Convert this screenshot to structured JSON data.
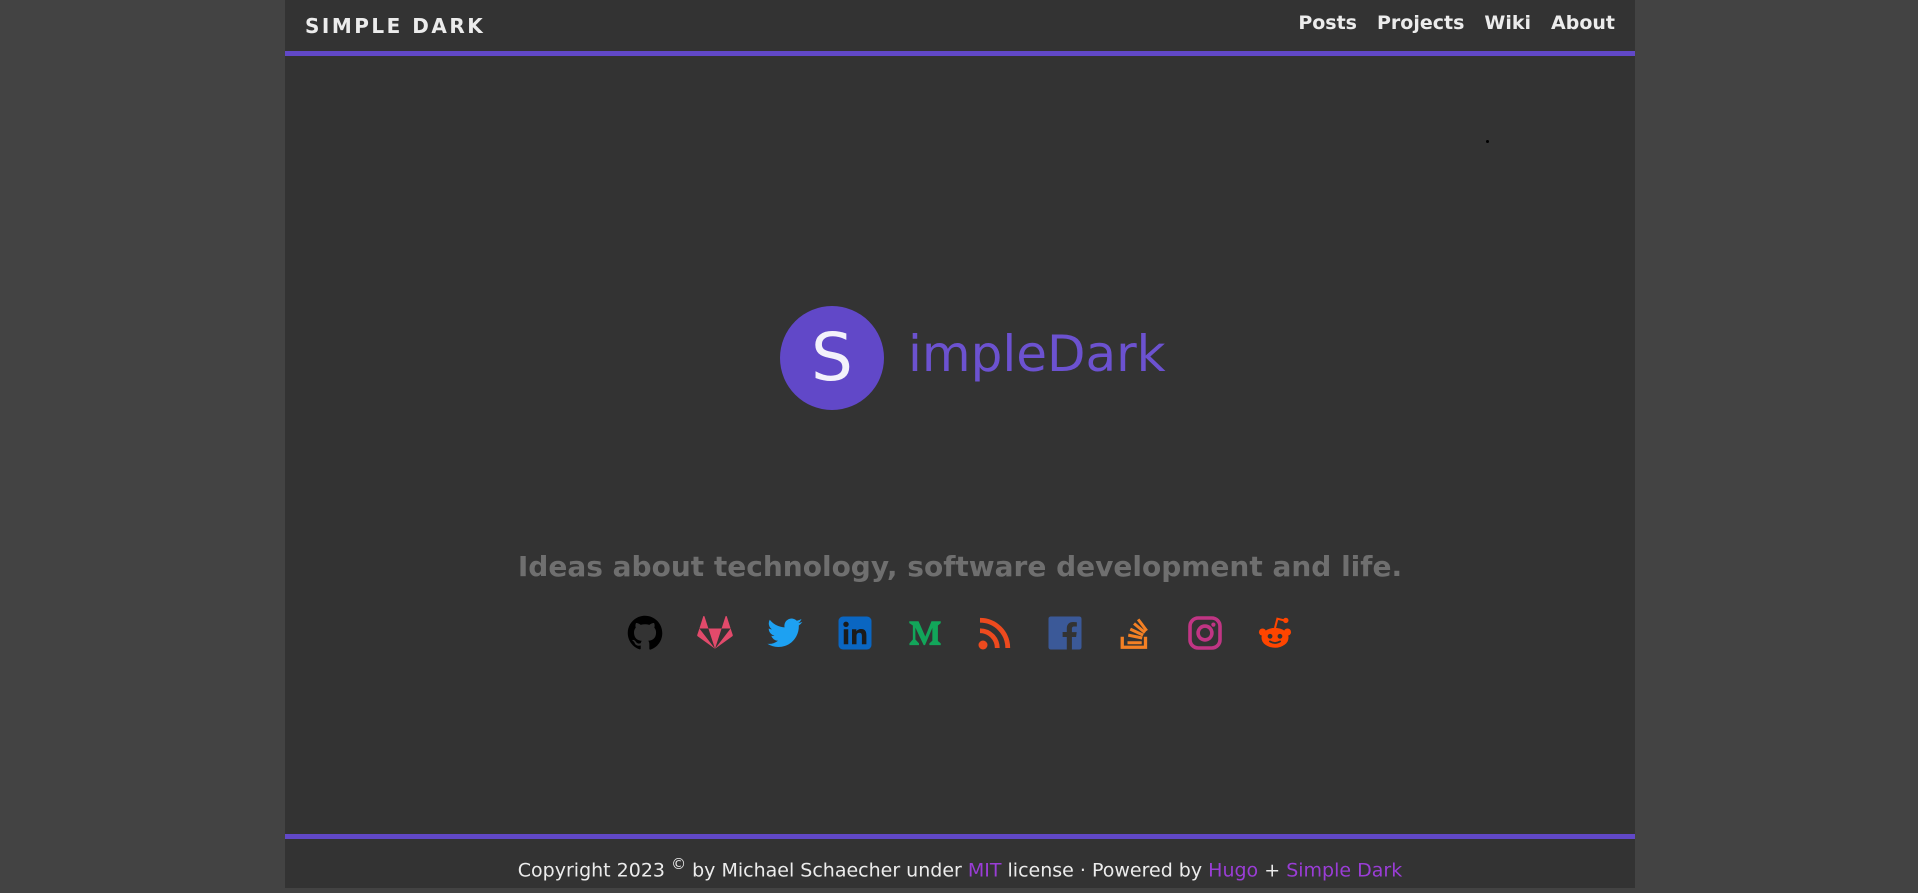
{
  "header": {
    "brand": "SIMPLE DARK",
    "nav": [
      "Posts",
      "Projects",
      "Wiki",
      "About"
    ]
  },
  "hero": {
    "logo_letter": "S",
    "logo_text": "impleDark",
    "tagline": "Ideas about technology, software development and life."
  },
  "socials": [
    {
      "name": "github-icon",
      "color": "#000000"
    },
    {
      "name": "gitlab-icon",
      "color": "#e24a6b"
    },
    {
      "name": "twitter-icon",
      "color": "#1da1f2"
    },
    {
      "name": "linkedin-icon",
      "color": "#0a66c2"
    },
    {
      "name": "medium-icon",
      "color": "#12a65a"
    },
    {
      "name": "rss-icon",
      "color": "#ee4a1e"
    },
    {
      "name": "facebook-icon",
      "color": "#3b5998"
    },
    {
      "name": "stackoverflow-icon",
      "color": "#f48024"
    },
    {
      "name": "instagram-icon",
      "color": "#c13584"
    },
    {
      "name": "reddit-icon",
      "color": "#ff4500"
    }
  ],
  "footer": {
    "copyright_prefix": "Copyright 2023",
    "copyright_symbol": "©",
    "by_text": "by Michael Schaecher under",
    "license_link": "MIT",
    "license_text": "license · Powered by",
    "hugo_link": "Hugo",
    "plus": "+",
    "theme_link": "Simple Dark"
  },
  "colors": {
    "accent": "#6148c8",
    "background": "#333333",
    "outer_background": "#434343",
    "link": "#9a3dd6"
  }
}
